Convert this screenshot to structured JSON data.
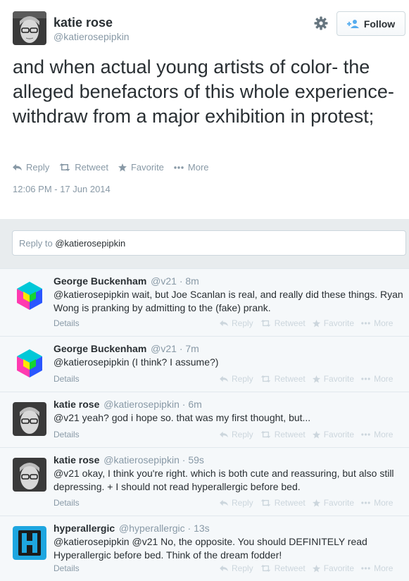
{
  "tweet": {
    "author_name": "katie rose",
    "author_handle": "@katierosepipkin",
    "follow_label": "Follow",
    "text": "and when actual young artists of color- the alleged benefactors of this whole experience- withdraw from a major exhibition in protest;",
    "actions": {
      "reply": "Reply",
      "retweet": "Retweet",
      "favorite": "Favorite",
      "more": "More"
    },
    "timestamp": "12:06 PM - 17 Jun 2014"
  },
  "reply_box": {
    "prefix": "Reply to ",
    "mention": "@katierosepipkin"
  },
  "reply_actions": {
    "reply": "Reply",
    "retweet": "Retweet",
    "favorite": "Favorite",
    "more": "More",
    "details": "Details"
  },
  "replies": [
    {
      "name": "George Buckenham",
      "handle": "@v21",
      "time": "· 8m",
      "avatar": "cube-icon",
      "text": "@katierosepipkin wait, but Joe Scanlan is real, and really did these things. Ryan Wong is pranking by admitting to the (fake) prank."
    },
    {
      "name": "George Buckenham",
      "handle": "@v21",
      "time": "· 7m",
      "avatar": "cube-icon",
      "text": "@katierosepipkin (I think? I assume?)"
    },
    {
      "name": "katie rose",
      "handle": "@katierosepipkin",
      "time": "· 6m",
      "avatar": "portrait",
      "text": "@v21 yeah? god i hope so. that was my first thought, but..."
    },
    {
      "name": "katie rose",
      "handle": "@katierosepipkin",
      "time": "· 59s",
      "avatar": "portrait",
      "text": "@v21 okay, I think you're right. which is both cute and reassuring, but also still depressing. + I should not read hyperallergic before bed."
    },
    {
      "name": "hyperallergic",
      "handle": "@hyperallergic",
      "time": "· 13s",
      "avatar": "h-logo",
      "text": "@katierosepipkin @v21 No, the opposite. You should DEFINITELY read Hyperallergic before bed. Think of the dream fodder!"
    }
  ]
}
